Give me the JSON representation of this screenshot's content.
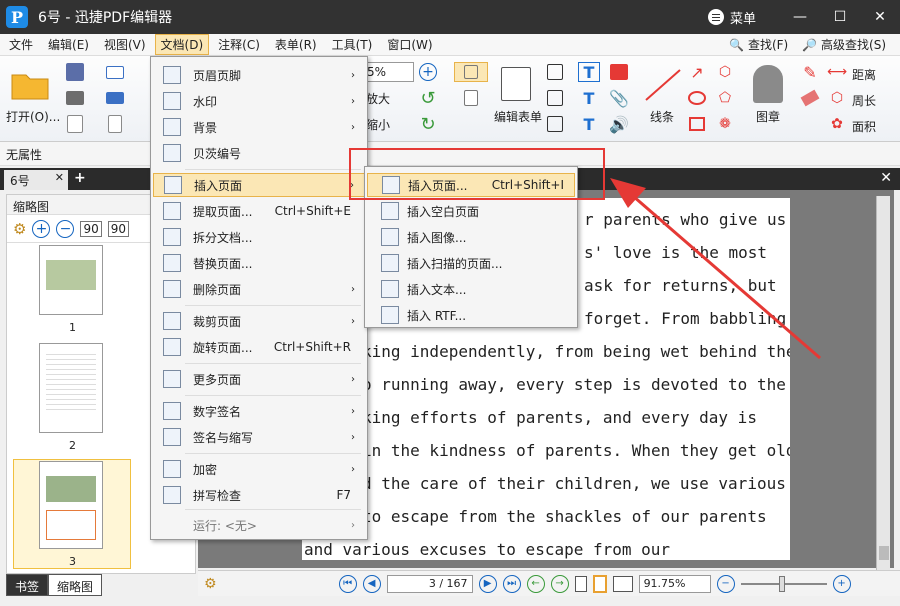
{
  "title_bar": {
    "app_logo": "P",
    "title": "6号 - 迅捷PDF编辑器",
    "menu_label": "菜单",
    "min_glyph": "—",
    "max_glyph": "☐",
    "close_glyph": "✕"
  },
  "menubar": {
    "items": [
      "文件",
      "编辑(E)",
      "视图(V)",
      "文档(D)",
      "注释(C)",
      "表单(R)",
      "工具(T)",
      "窗口(W)"
    ],
    "right": [
      "查找(F)",
      "高级查找(S)"
    ]
  },
  "ribbon": {
    "open_label": "打开(O)...",
    "zoom_value": "5%",
    "zoom_in_label": "放大",
    "zoom_out_label": "缩小",
    "edit_form_label": "编辑表单",
    "line_label": "线条",
    "image_label": "图章",
    "distance_label": "距离",
    "perimeter_label": "周长",
    "area_label": "面积"
  },
  "property_bar": {
    "text": "无属性"
  },
  "doc_tab": {
    "label": "6号",
    "close": "✕",
    "plus": "+"
  },
  "left_panel": {
    "title": "缩略图",
    "pages": [
      "1",
      "2",
      "3"
    ],
    "bottom_tabs": [
      "书签",
      "缩略图"
    ]
  },
  "document": {
    "lines": [
      "r parents who give us",
      "s' love is the most",
      "ask for returns, but",
      "forget. From babbling",
      "king independently, from being wet behind the",
      "o running away, every step is devoted to the",
      "king efforts of parents, and every day is",
      "in the kindness of parents. When they get old",
      "d the care of their children, we use various",
      "to escape from the shackles of our parents",
      "and various excuses to escape from our"
    ]
  },
  "status_bar": {
    "page_value": "3 / 167",
    "zoom_value": "91.75%"
  },
  "doc_menu": {
    "items": [
      {
        "label": "页眉页脚",
        "shortcut": "",
        "arrow": "›"
      },
      {
        "label": "水印",
        "shortcut": "",
        "arrow": "›"
      },
      {
        "label": "背景",
        "shortcut": "",
        "arrow": "›"
      },
      {
        "label": "贝茨编号",
        "shortcut": "",
        "arrow": ""
      },
      {
        "label": "插入页面",
        "shortcut": "",
        "arrow": "›"
      },
      {
        "label": "提取页面...",
        "shortcut": "Ctrl+Shift+E",
        "arrow": ""
      },
      {
        "label": "拆分文档...",
        "shortcut": "",
        "arrow": ""
      },
      {
        "label": "替换页面...",
        "shortcut": "",
        "arrow": ""
      },
      {
        "label": "删除页面",
        "shortcut": "",
        "arrow": "›"
      },
      {
        "label": "裁剪页面",
        "shortcut": "",
        "arrow": "›"
      },
      {
        "label": "旋转页面...",
        "shortcut": "Ctrl+Shift+R",
        "arrow": ""
      },
      {
        "label": "更多页面",
        "shortcut": "",
        "arrow": "›"
      },
      {
        "label": "数字签名",
        "shortcut": "",
        "arrow": "›"
      },
      {
        "label": "签名与缩写",
        "shortcut": "",
        "arrow": "›"
      },
      {
        "label": "加密",
        "shortcut": "",
        "arrow": "›"
      },
      {
        "label": "拼写检查",
        "shortcut": "F7",
        "arrow": ""
      },
      {
        "label": "运行: <无>",
        "shortcut": "",
        "arrow": "›"
      }
    ]
  },
  "insert_submenu": {
    "items": [
      {
        "label": "插入页面...",
        "shortcut": "Ctrl+Shift+I"
      },
      {
        "label": "插入空白页面",
        "shortcut": ""
      },
      {
        "label": "插入图像...",
        "shortcut": ""
      },
      {
        "label": "插入扫描的页面...",
        "shortcut": ""
      },
      {
        "label": "插入文本...",
        "shortcut": ""
      },
      {
        "label": "插入 RTF...",
        "shortcut": ""
      }
    ]
  },
  "colors": {
    "highlight": "#fbe7b5",
    "highlight_border": "#e8b34a",
    "annotation_red": "#e53935",
    "title_bg": "#323232"
  }
}
